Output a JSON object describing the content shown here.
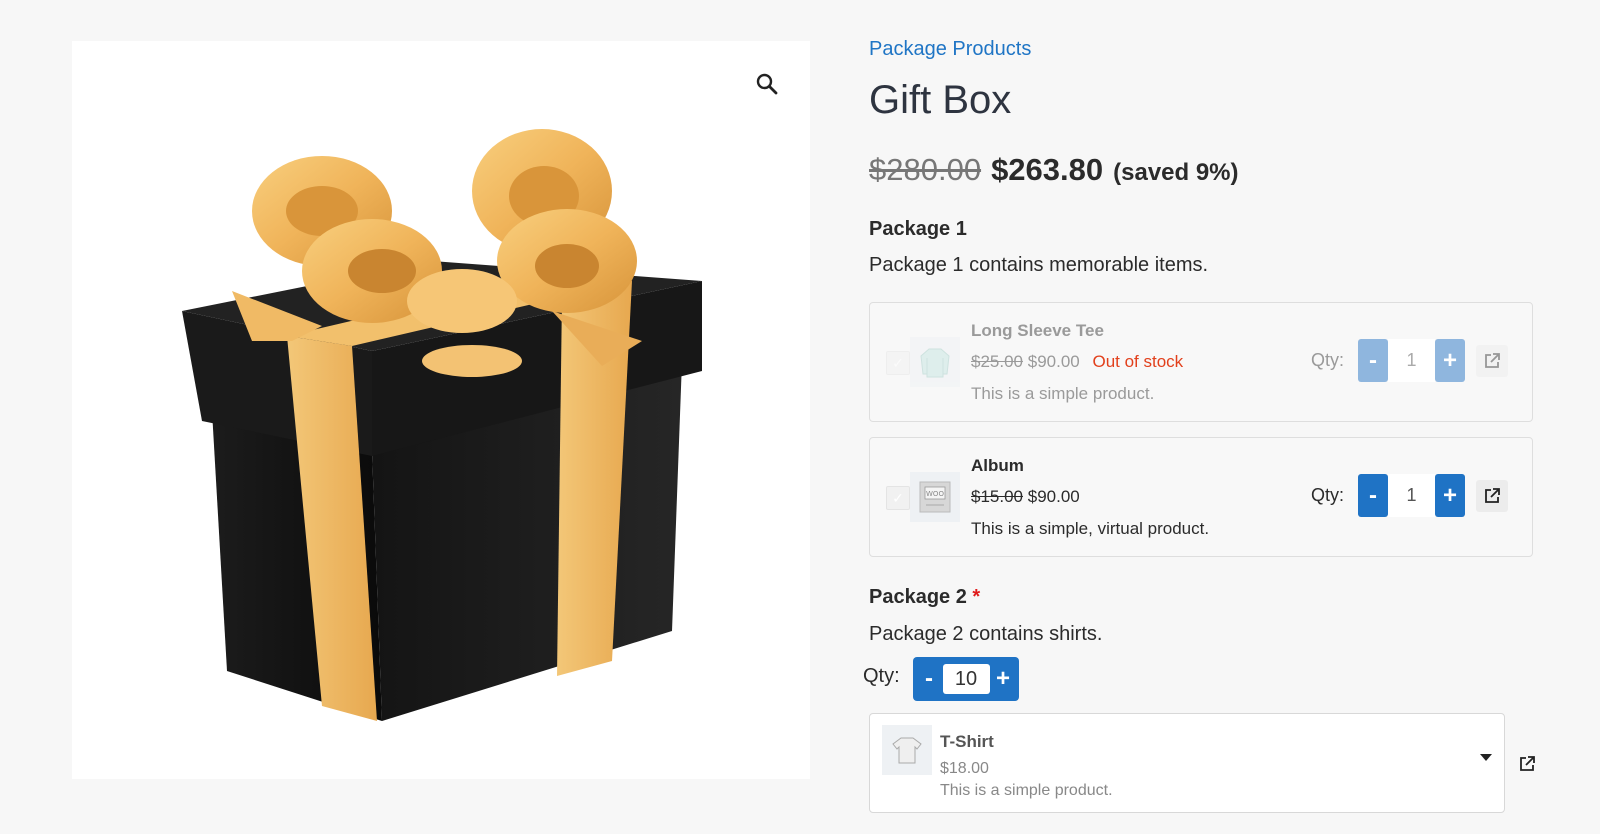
{
  "breadcrumb": "Package Products",
  "product": {
    "title": "Gift Box",
    "price_old": "$280.00",
    "price_new": "$263.80",
    "price_saved": "(saved 9%)"
  },
  "package1": {
    "title": "Package 1",
    "description": "Package 1 contains memorable items.",
    "items": [
      {
        "name": "Long Sleeve Tee",
        "price_old": "$25.00",
        "price_new": "$90.00",
        "stock_status": "Out of stock",
        "description": "This is a simple product.",
        "qty_label": "Qty:",
        "qty": "1",
        "minus": "-",
        "plus": "+"
      },
      {
        "name": "Album",
        "price_old": "$15.00",
        "price_new": "$90.00",
        "description": "This is a simple, virtual product.",
        "qty_label": "Qty:",
        "qty": "1",
        "minus": "-",
        "plus": "+"
      }
    ]
  },
  "package2": {
    "title": "Package 2",
    "required_mark": "*",
    "description": "Package 2 contains shirts.",
    "qty_label": "Qty:",
    "qty": "10",
    "minus": "-",
    "plus": "+",
    "selected": {
      "name": "T-Shirt",
      "price": "$18.00",
      "description": "This is a simple product."
    }
  },
  "icons": {
    "zoom": "search-icon",
    "external": "external-link-icon",
    "dropdown": "chevron-down-icon"
  },
  "colors": {
    "accent": "#1f73c5",
    "link": "#1f75c5",
    "out_of_stock": "#e2401c",
    "required": "#e01b1b"
  }
}
